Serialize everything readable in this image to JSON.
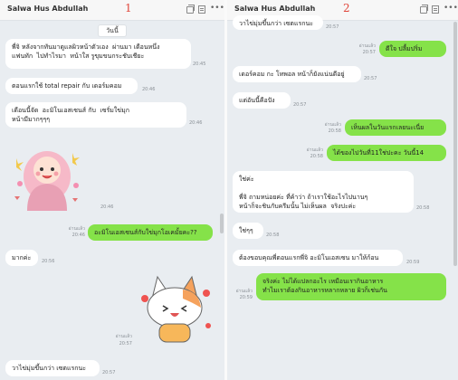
{
  "pane1": {
    "contact_name": "Salwa Hus Abdullah",
    "pane_number": "1",
    "date_chip": "วันนี้",
    "messages": [
      {
        "text": "พี่จิ หลังจากทันมาดูแลผิวหน้าตัวเอง  ผ่านมา เดือนหนึ่ง\nแฟนทัก  ไปทำไรมา  หน้าใส รูขุมขนกระชับเชียะ",
        "time": "20:45"
      },
      {
        "text": "ตอนแรกใช้ total repair กับ เดอร์มคอม",
        "time": "20:46"
      },
      {
        "text": "เดือนนี้จัด  อะมิโนเอสเซนส์ กับ  เซรั่มใข่มุก\nหน้ามีมากๆๆๆ",
        "time": "20:46"
      },
      {
        "text": "อะมิโนเอสเซนส์กับใข่มุกโอเคมั้ยคะ??",
        "time": "20:46",
        "read": "อ่านแล้ว"
      },
      {
        "text": "มากค่ะ",
        "time": "20:56"
      },
      {
        "text": "วาไข่มุ่มขึ้นกว่า เซตแรกนะ",
        "time": "20:57"
      }
    ],
    "sticker_time": "20:46",
    "cat_sticker_read": "อ่านแล้ว",
    "cat_sticker_time": "20:57"
  },
  "pane2": {
    "contact_name": "Salwa Hus Abdullah",
    "pane_number": "2",
    "messages": [
      {
        "text": "วาไข่มุ่มขึ้นกว่า เซตแรกนะ",
        "time": "20:57"
      },
      {
        "text": "ดีใจ ปลื้มปริ่ม",
        "time": "20:57",
        "read": "อ่านแล้ว"
      },
      {
        "text": "เดอร์คอม กะ โทพอล หน้าก็ยังแน่นดีอยู่",
        "time": "20:57"
      },
      {
        "text": "แต่อันนี้คือปัง",
        "time": "20:57"
      },
      {
        "text": "เห็นผลในวันแรกเลยนะเนี่ย",
        "time": "20:58",
        "read": "อ่านแล้ว"
      },
      {
        "text": "ได้ของไปวันที่11ใช่ปะคะ วันนี้14",
        "time": "20:58",
        "read": "อ่านแล้ว"
      },
      {
        "text": "ใช่ค่ะ\n\nพี่จิ ถามหน่อยค่ะ ที่ค้าว่า ถ้าเราใช้อะไรไปนานๆ\nหน้าก็จะชินกับครีมนั้น ไม่เห็นผล  จริงปะค่ะ",
        "time": "20:58"
      },
      {
        "text": "ใช่ๆๆ",
        "time": "20:58"
      },
      {
        "text": "ต้องขอบคุณพี่ตอนแรกพี่จิ อะมิโนเอสเซน มาให้ก้อน",
        "time": "20:59"
      },
      {
        "text": "จริงค่ะ ไม่ได้แปลกอะไร เหมือนเรากินอาหาร\nทำไมเราต้องกินอาหารหลากหลาย ผิวก็เช่นกัน",
        "time": "20:59",
        "read": "อ่านแล้ว"
      }
    ]
  },
  "colors": {
    "incoming_bubble": "#ffffff",
    "outgoing_bubble": "#85e249",
    "chat_background": "#e9edf1",
    "pane_number": "#e0473c"
  },
  "icons": [
    "copy-icon",
    "note-icon",
    "more-icon",
    "girl-sticker",
    "cat-sticker"
  ]
}
